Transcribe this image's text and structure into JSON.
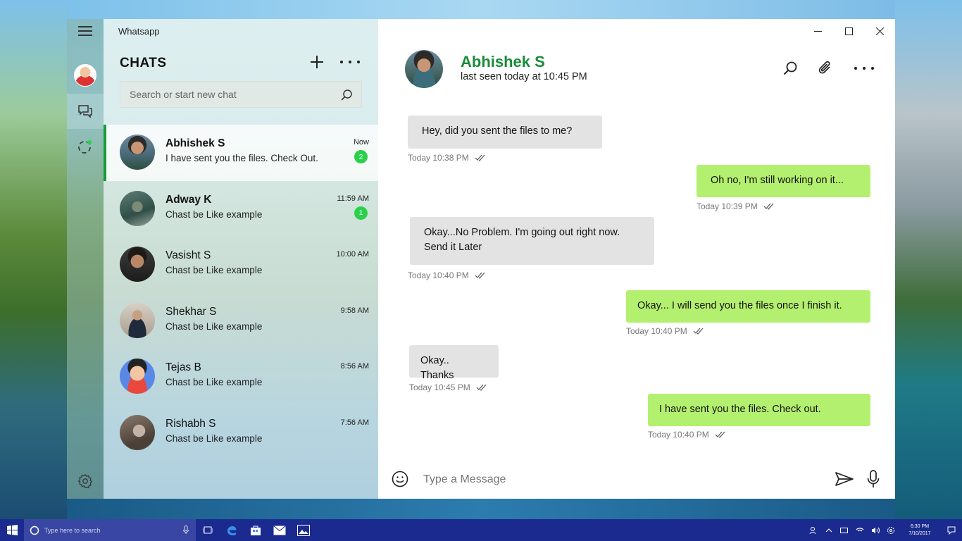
{
  "window": {
    "app_title": "Whatsapp"
  },
  "sidebar": {
    "heading": "CHATS"
  },
  "search": {
    "placeholder": "Search or start new chat"
  },
  "conversations": [
    {
      "name": "Abhishek S",
      "preview": "I have sent you the files. Check Out.",
      "time": "Now",
      "unread": "2",
      "bold": true,
      "active": true
    },
    {
      "name": "Adway K",
      "preview": "Chast be Like example",
      "time": "11:59 AM",
      "unread": "1",
      "bold": true,
      "active": false
    },
    {
      "name": "Vasisht S",
      "preview": "Chast be Like example",
      "time": "10:00 AM",
      "unread": "",
      "bold": false,
      "active": false
    },
    {
      "name": "Shekhar S",
      "preview": "Chast be Like example",
      "time": "9:58 AM",
      "unread": "",
      "bold": false,
      "active": false
    },
    {
      "name": "Tejas B",
      "preview": "Chast be Like example",
      "time": "8:56 AM",
      "unread": "",
      "bold": false,
      "active": false
    },
    {
      "name": "Rishabh S",
      "preview": "Chast be Like example",
      "time": "7:56 AM",
      "unread": "",
      "bold": false,
      "active": false
    }
  ],
  "contact": {
    "name": "Abhishek S",
    "last_seen": "last seen today at 10:45 PM"
  },
  "messages": [
    {
      "direction": "in",
      "text": "Hey, did you sent the files to me?",
      "time": "Today 10:38 PM"
    },
    {
      "direction": "out",
      "text": "Oh no, I'm still working on it...",
      "time": "Today 10:39 PM"
    },
    {
      "direction": "in",
      "text": "Okay...No Problem. I'm going out right now. Send it Later",
      "time": "Today 10:40 PM"
    },
    {
      "direction": "out",
      "text": "Okay... I will send you the files once I finish it.",
      "time": "Today 10:40 PM"
    },
    {
      "direction": "in",
      "text": "Okay.. Thanks",
      "time": "Today 10:45 PM"
    },
    {
      "direction": "out",
      "text": "I have sent you the files. Check out.",
      "time": "Today 10:40 PM"
    }
  ],
  "composer": {
    "placeholder": "Type a Message"
  },
  "taskbar": {
    "search_placeholder": "Type here to search",
    "clock_time": "6:30 PM",
    "clock_date": "7/10/2017"
  },
  "colors": {
    "accent_green": "#1a8c3a",
    "badge_green": "#2ad04a",
    "outgoing_bubble": "#b4f06f",
    "incoming_bubble": "#e3e3e3",
    "taskbar": "#1b2a8f"
  },
  "icons": [
    "hamburger-icon",
    "profile-avatar",
    "chat-icon",
    "status-icon",
    "settings-icon",
    "plus-icon",
    "more-icon",
    "search-icon",
    "attach-icon",
    "emoji-icon",
    "send-icon",
    "mic-icon",
    "double-check-icon"
  ]
}
